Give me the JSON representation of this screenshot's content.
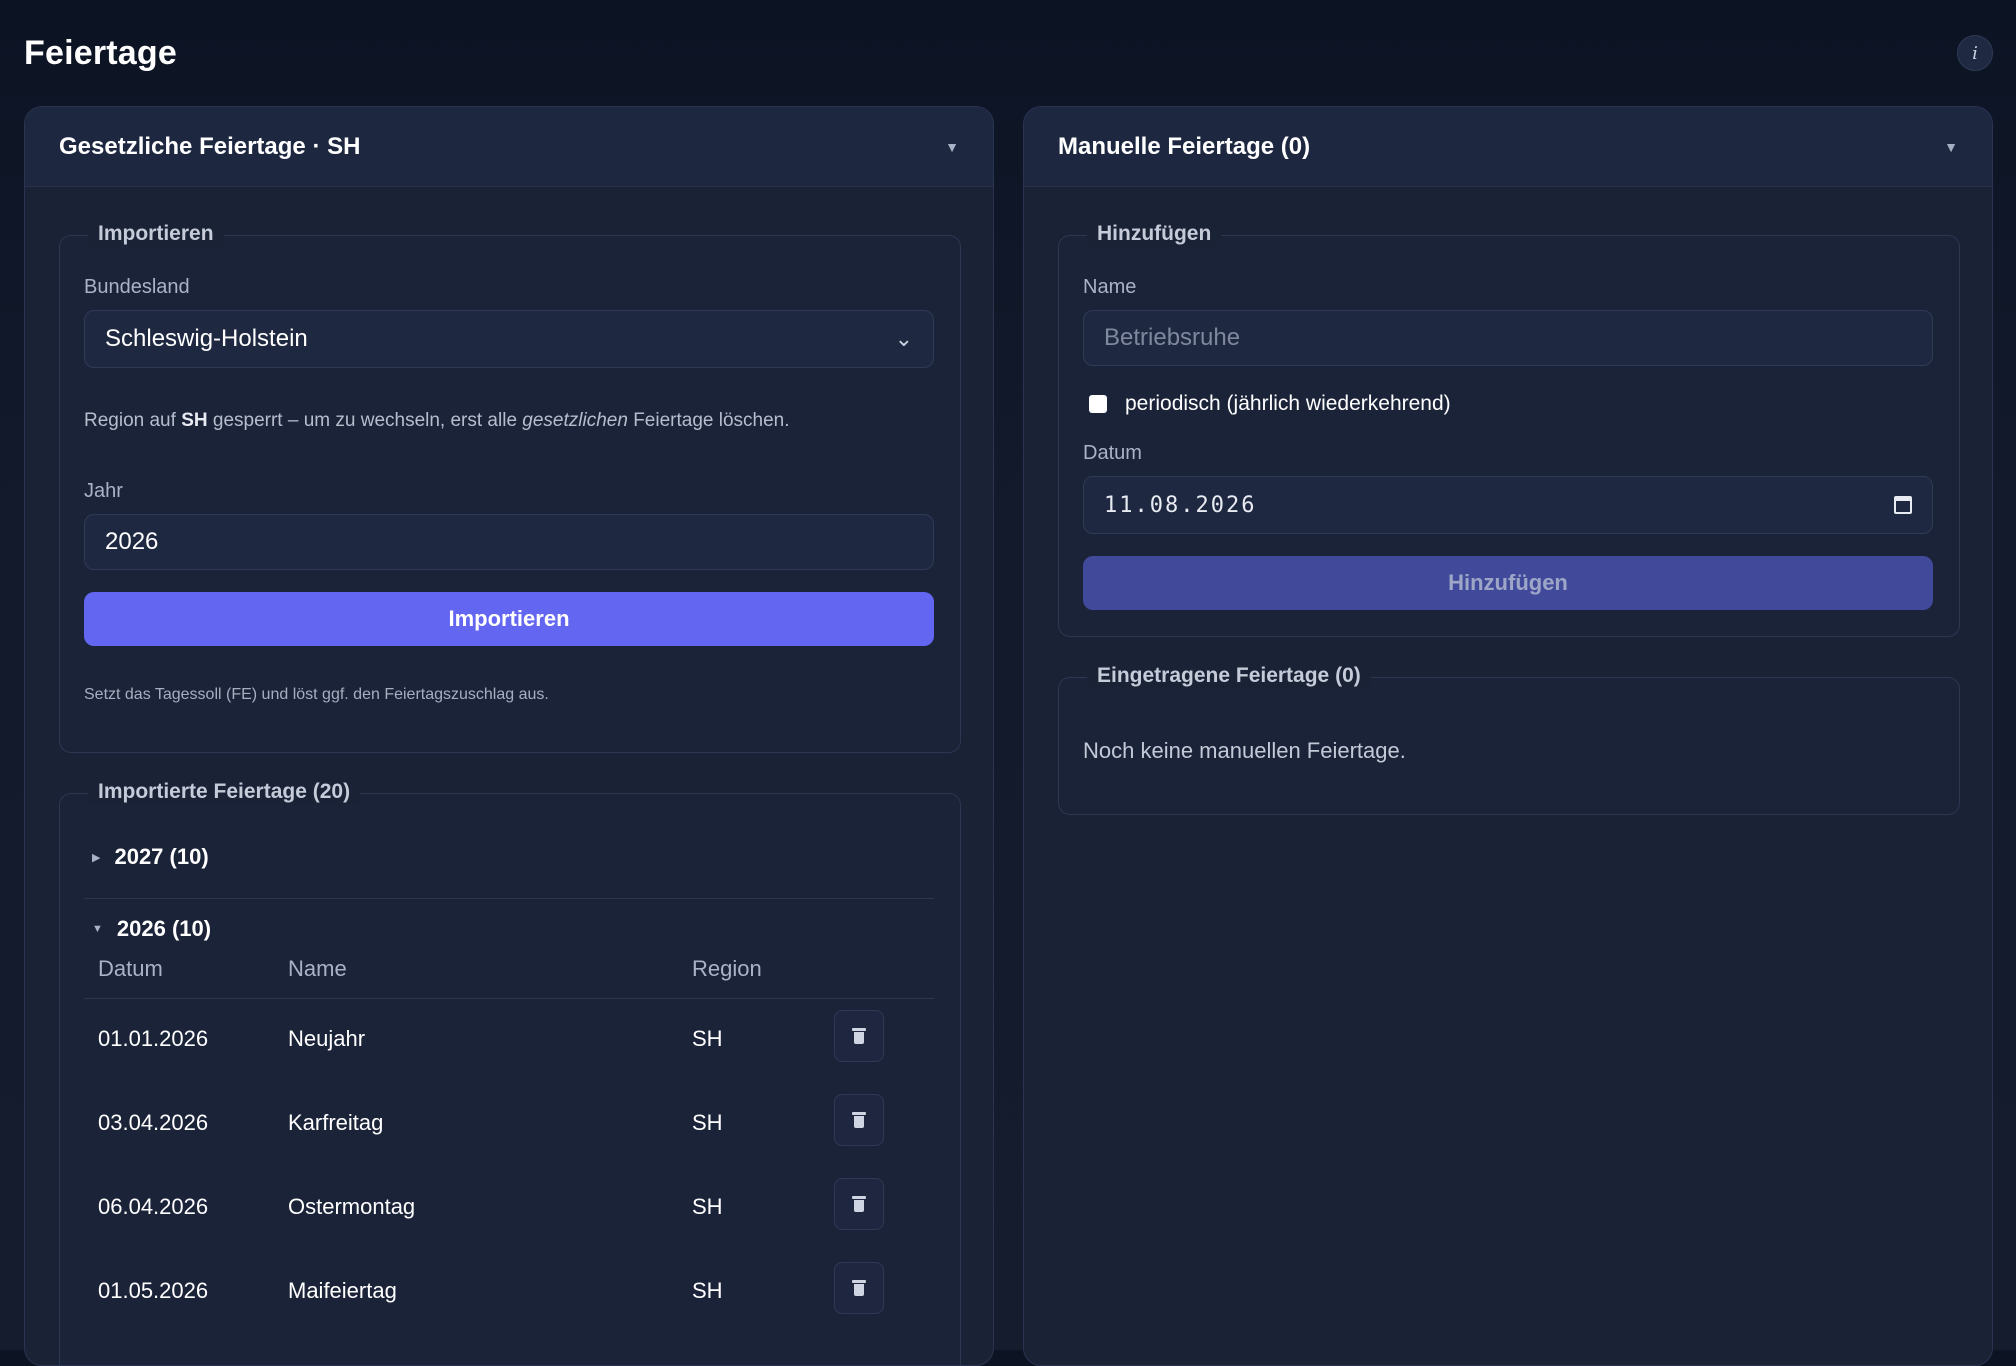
{
  "page": {
    "title": "Feiertage",
    "info_label": "i"
  },
  "left_card": {
    "title": "Gesetzliche Feiertage · SH",
    "import_group": {
      "legend": "Importieren",
      "state_label": "Bundesland",
      "state_value": "Schleswig-Holstein",
      "lock_note": {
        "prefix": "Region auf ",
        "region": "SH",
        "middle": " gesperrt – um zu wechseln, erst alle ",
        "emphasis": "gesetzlichen",
        "suffix": " Feiertage löschen."
      },
      "year_label": "Jahr",
      "year_value": "2026",
      "import_button": "Importieren",
      "footnote": "Setzt das Tagessoll (FE) und löst ggf. den Feiertagszuschlag aus."
    },
    "imported_group": {
      "legend": "Importierte Feiertage (20)",
      "years": [
        {
          "label": "2027 (10)",
          "expanded": false
        },
        {
          "label": "2026 (10)",
          "expanded": true
        }
      ],
      "columns": [
        "Datum",
        "Name",
        "Region"
      ],
      "rows": [
        {
          "date": "01.01.2026",
          "name": "Neujahr",
          "region": "SH"
        },
        {
          "date": "03.04.2026",
          "name": "Karfreitag",
          "region": "SH"
        },
        {
          "date": "06.04.2026",
          "name": "Ostermontag",
          "region": "SH"
        },
        {
          "date": "01.05.2026",
          "name": "Maifeiertag",
          "region": "SH"
        }
      ]
    }
  },
  "right_card": {
    "title": "Manuelle Feiertage (0)",
    "add_group": {
      "legend": "Hinzufügen",
      "name_label": "Name",
      "name_placeholder": "Betriebsruhe",
      "periodic_label": "periodisch (jährlich wiederkehrend)",
      "date_label": "Datum",
      "date_value": "11.08.2026",
      "add_button": "Hinzufügen"
    },
    "entries_group": {
      "legend": "Eingetragene Feiertage (0)",
      "empty_text": "Noch keine manuellen Feiertage."
    }
  },
  "colors": {
    "accent": "#6366f1",
    "background": "#121a2c",
    "card": "#1a2236"
  }
}
